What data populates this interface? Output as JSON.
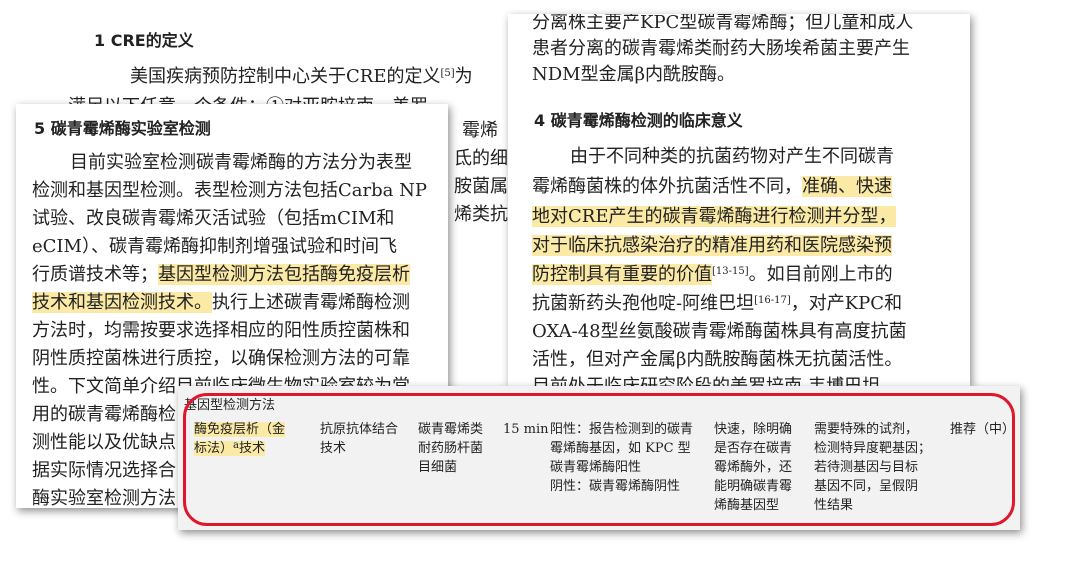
{
  "back_card": {
    "heading": "1   CRE的定义",
    "line1": "美国疾病预防控制中心关于CRE的定义",
    "line1_ref": "[5]",
    "line1_tail": "为",
    "line2": "满足以下任意一个条件：①对亚胺培南、美罗",
    "fragments": [
      "霉烯",
      "氐的细",
      "胺菌属",
      "烯类抗"
    ]
  },
  "right_card": {
    "top_lines": [
      "分离株主要产KPC型碳青霉烯酶；但儿童和成人",
      "患者分离的碳青霉烯类耐药大肠埃希菌主要产生",
      "NDM型金属β内酰胺酶。"
    ],
    "heading": "4   碳青霉烯酶检测的临床意义",
    "p1_l1": "由于不同种类的抗菌药物对产生不同碳青",
    "p1_l2_plain": "霉烯酶菌株的体外抗菌活性不同，",
    "p1_l2_hl": "准确、快速",
    "p1_l3_hl": "地对CRE产生的碳青霉烯酶进行检测并分型，",
    "p1_l4_hl": "对于临床抗感染治疗的精准用药和医院感染预",
    "p1_l5_hl": "防控制具有重要的价值",
    "p1_l5_ref": "[13-15]",
    "p1_l5_tail": "。如目前刚上市的",
    "p1_l6": "抗菌新药头孢他啶-阿维巴坦",
    "p1_l6_ref": "[16-17]",
    "p1_l6_tail": "，对产KPC和",
    "p1_l7": "OXA-48型丝氨酸碳青霉烯酶菌株具有高度抗菌",
    "p1_l8": "活性，但对产金属β内酰胺酶菌株无抗菌活性。",
    "p1_l9": "目前处于临床研究阶段的美罗培南-韦博巴坦"
  },
  "left_card": {
    "heading": "5   碳青霉烯酶实验室检测",
    "l1": "目前实验室检测碳青霉烯酶的方法分为表型",
    "l2": "检测和基因型检测。表型检测方法包括Carba NP",
    "l3": "试验、改良碳青霉烯灭活试验（包括mCIM和",
    "l4": "eCIM）、碳青霉烯酶抑制剂增强试验和时间飞",
    "l5_plain": "行质谱技术等；",
    "l5_hl": "基因型检测方法包括酶免疫层析",
    "l6_hl": "技术和基因检测技术。",
    "l6_tail": "执行上述碳青霉烯酶检测",
    "l7": "方法时，均需按要求选择相应的阳性质控菌株和",
    "l8": "阴性质控菌株进行质控，以确保检测方法的可靠",
    "l9": "性。下文简单介绍目前临床微生物实验室较为常",
    "l10": "用的碳青霉烯酶检",
    "l11": "测性能以及优缺点",
    "l12": "据实际情况选择合",
    "l13": "酶实验室检测方法"
  },
  "table": {
    "section": "基因型检测方法",
    "method_l1": "酶免疫层析（金",
    "method_l2": "标法）",
    "method_sup": "a",
    "method_l2_tail": "技术",
    "principle": [
      "抗原抗体结合",
      "技术"
    ],
    "scope": [
      "碳青霉烯类",
      "耐药肠杆菌",
      "目细菌"
    ],
    "time": "15 min",
    "interpretation": [
      "阳性：报告检测到的碳青",
      "霉烯酶基因，如 KPC 型",
      "碳青霉烯酶阳性",
      "阴性：碳青霉烯酶阴性"
    ],
    "advantages": [
      "快速，除明确",
      "是否存在碳青",
      "霉烯酶外，还",
      "能明确碳青霉",
      "烯酶基因型"
    ],
    "disadvantages": [
      "需要特殊的试剂，",
      "检测特异度靶基因；",
      "若待测基因与目标",
      "基因不同，呈假阴",
      "性结果"
    ],
    "recommendation": "推荐（中）"
  },
  "colors": {
    "highlight": "#fbe9a6",
    "frame": "#e0162b"
  }
}
